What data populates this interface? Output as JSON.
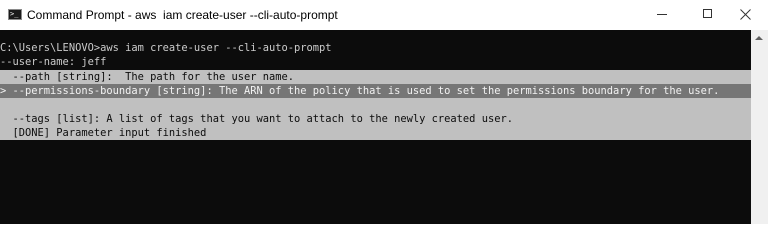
{
  "window": {
    "title": "Command Prompt - aws  iam create-user --cli-auto-prompt",
    "icon": "cmd-icon",
    "icon_text": ">_",
    "controls": [
      "minimize-icon",
      "maximize-icon",
      "close-icon"
    ]
  },
  "console": {
    "lines": [
      "",
      "C:\\Users\\LENOVO>aws iam create-user --cli-auto-prompt",
      "--user-name: jeff",
      "  --path [string]:  The path for the user name.",
      "> --permissions-boundary [string]: The ARN of the policy that is used to set the permissions boundary for the user.",
      "",
      "  --tags [list]: A list of tags that you want to attach to the newly created user.",
      "  [DONE] Parameter input finished"
    ],
    "colors": {
      "background": "#0c0c0c",
      "text": "#cccccc",
      "completion_bg": "#c0c0c0",
      "selected_bg": "#767676"
    }
  }
}
